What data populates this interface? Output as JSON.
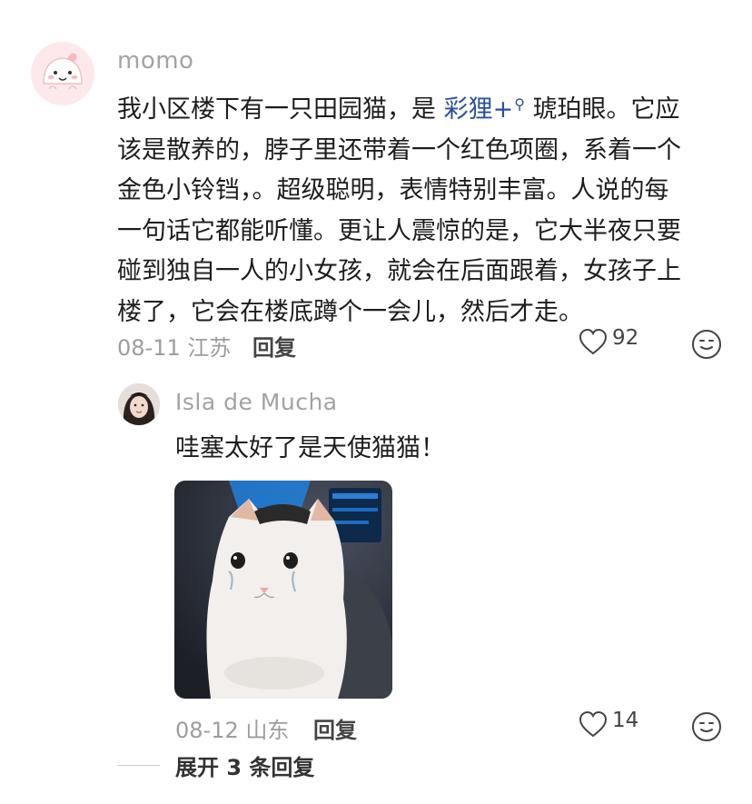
{
  "comment": {
    "username": "momo",
    "text_before_link": "我小区楼下有一只田园猫，是",
    "link_text": "彩狸",
    "link_plus": "+",
    "text_lines": [
      "琥珀眼。它应",
      "该是散养的，脖子里还带着一个红色项圈，系着一个",
      "金色小铃铛，。超级聪明，表情特别丰富。人说的每",
      "一句话它都能听懂。更让人震惊的是，它大半夜只要",
      "碰到独自一人的小女孩，就会在后面跟着，女孩子上",
      "楼了，它会在楼底蹲个一会儿，然后才走。"
    ],
    "date": "08-11",
    "location": "江苏",
    "reply_label": "回复",
    "like_count": "92"
  },
  "reply": {
    "username": "Isla de Mucha",
    "text": "哇塞太好了是天使猫猫！",
    "date": "08-12",
    "location": "山东",
    "reply_label": "回复",
    "like_count": "14"
  },
  "expand": {
    "label": "展开 3 条回复"
  },
  "colors": {
    "link": "#2b4fa0",
    "meta": "#9d9d9d",
    "username": "#a3a3a3"
  },
  "icons": {
    "like": "heart-outline-icon",
    "emoji": "smile-face-icon",
    "link_search": "search-icon"
  }
}
